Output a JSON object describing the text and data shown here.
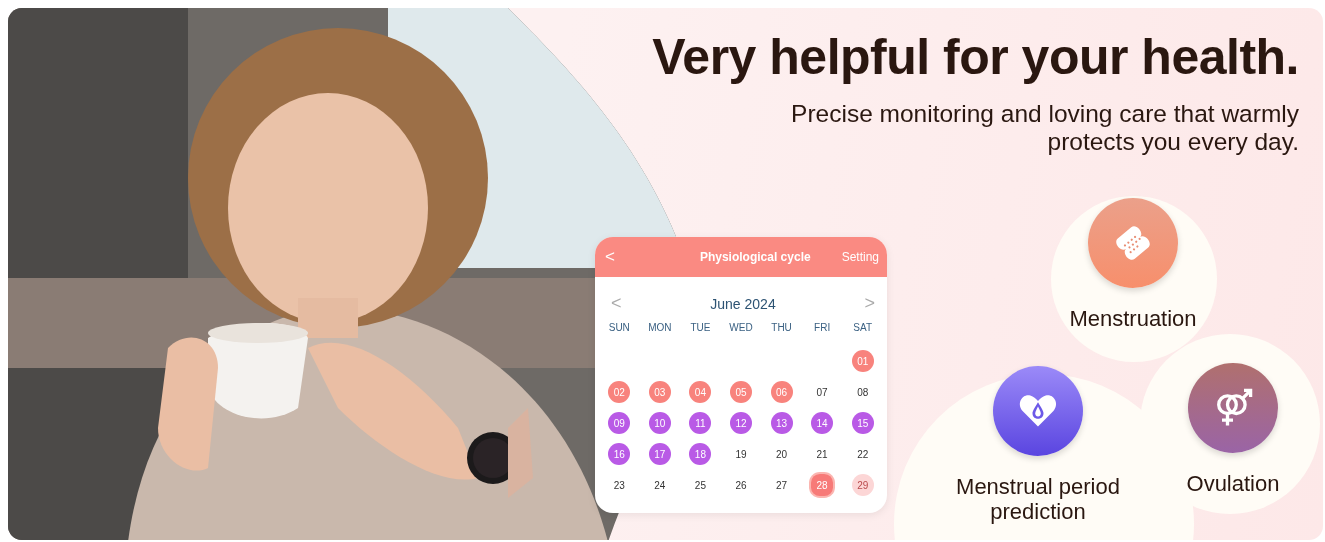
{
  "headline": "Very helpful for your health.",
  "subtitle": "Precise monitoring and loving care that warmly protects you every day.",
  "calendar": {
    "back": "<",
    "title": "Physiological cycle",
    "setting": "Setting",
    "prev": "<",
    "month": "June 2024",
    "next": ">",
    "weekdays": [
      "SUN",
      "MON",
      "TUE",
      "WED",
      "THU",
      "FRI",
      "SAT"
    ],
    "weeks": [
      [
        {
          "day": "01",
          "kind": "period"
        }
      ],
      [
        {
          "day": "02",
          "kind": "period"
        },
        {
          "day": "03",
          "kind": "period"
        },
        {
          "day": "04",
          "kind": "period"
        },
        {
          "day": "05",
          "kind": "period"
        },
        {
          "day": "06",
          "kind": "period"
        },
        {
          "day": "07",
          "kind": "plain"
        },
        {
          "day": "08",
          "kind": "plain"
        }
      ],
      [
        {
          "day": "09",
          "kind": "fertile"
        },
        {
          "day": "10",
          "kind": "fertile"
        },
        {
          "day": "11",
          "kind": "fertile"
        },
        {
          "day": "12",
          "kind": "fertile"
        },
        {
          "day": "13",
          "kind": "fertile"
        },
        {
          "day": "14",
          "kind": "fertile"
        },
        {
          "day": "15",
          "kind": "fertile"
        }
      ],
      [
        {
          "day": "16",
          "kind": "fertile"
        },
        {
          "day": "17",
          "kind": "fertile"
        },
        {
          "day": "18",
          "kind": "fertile"
        },
        {
          "day": "19",
          "kind": "plain"
        },
        {
          "day": "20",
          "kind": "plain"
        },
        {
          "day": "21",
          "kind": "plain"
        },
        {
          "day": "22",
          "kind": "plain"
        }
      ],
      [
        {
          "day": "23",
          "kind": "plain"
        },
        {
          "day": "24",
          "kind": "plain"
        },
        {
          "day": "25",
          "kind": "plain"
        },
        {
          "day": "26",
          "kind": "plain"
        },
        {
          "day": "27",
          "kind": "plain"
        },
        {
          "day": "28",
          "kind": "flower"
        },
        {
          "day": "29",
          "kind": "faded"
        }
      ]
    ]
  },
  "features": [
    {
      "label": "Menstruation",
      "kind": "pad"
    },
    {
      "label": "Menstrual period prediction",
      "kind": "drop"
    },
    {
      "label": "Ovulation",
      "kind": "gender"
    }
  ]
}
